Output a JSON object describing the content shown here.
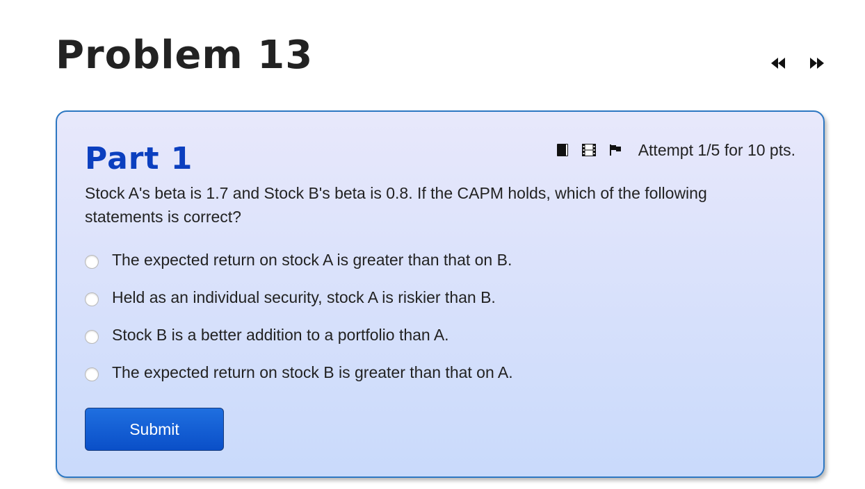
{
  "header": {
    "title": "Problem 13",
    "nav": {
      "prev_icon": "rewind-icon",
      "next_icon": "fast-forward-icon"
    }
  },
  "part": {
    "title": "Part 1",
    "toolbar": {
      "icons": [
        "book-icon",
        "film-icon",
        "flag-icon"
      ],
      "attempt_text": "Attempt 1/5 for 10 pts."
    },
    "question": "Stock A's beta is 1.7 and Stock B's beta is 0.8. If the CAPM holds, which of the following statements is correct?",
    "options": [
      "The expected return on stock A is greater than that on B.",
      "Held as an individual security, stock A is riskier than B.",
      "Stock B is a better addition to a portfolio than A.",
      "The expected return on stock B is greater than that on A."
    ],
    "submit_label": "Submit"
  },
  "colors": {
    "part_title": "#0b3fbf",
    "card_border": "#2d77c2",
    "submit_bg": "#0a4fc8"
  }
}
